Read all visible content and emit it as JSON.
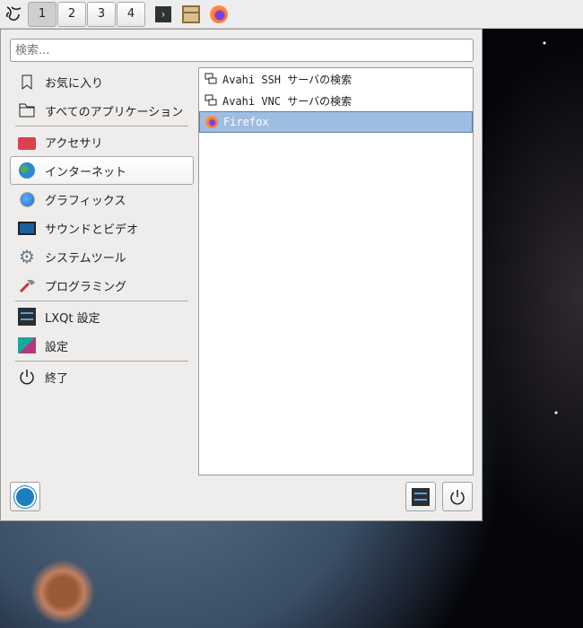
{
  "taskbar": {
    "desktops": [
      "1",
      "2",
      "3",
      "4"
    ],
    "active_desktop": "1",
    "icons": [
      "lxqt-logo-icon",
      "terminal-icon",
      "file-manager-icon",
      "firefox-icon"
    ]
  },
  "menu": {
    "search_placeholder": "検索...",
    "categories": [
      {
        "label": "お気に入り",
        "icon": "bookmark-icon"
      },
      {
        "label": "すべてのアプリケーション",
        "icon": "folder-icon"
      },
      {
        "label": "アクセサリ",
        "icon": "toolbox-icon"
      },
      {
        "label": "インターネット",
        "icon": "globe-icon",
        "selected": true
      },
      {
        "label": "グラフィックス",
        "icon": "graphics-icon"
      },
      {
        "label": "サウンドとビデオ",
        "icon": "monitor-play-icon"
      },
      {
        "label": "システムツール",
        "icon": "gear-icon"
      },
      {
        "label": "プログラミング",
        "icon": "hammer-icon"
      },
      {
        "label": "LXQt 設定",
        "icon": "lxqt-settings-icon"
      },
      {
        "label": "設定",
        "icon": "settings-icon"
      },
      {
        "label": "終了",
        "icon": "power-icon"
      }
    ],
    "apps": [
      {
        "label": "Avahi SSH サーバの検索",
        "icon": "network-icon"
      },
      {
        "label": "Avahi VNC サーバの検索",
        "icon": "network-icon"
      },
      {
        "label": "Firefox",
        "icon": "firefox-icon",
        "selected": true
      }
    ]
  },
  "colors": {
    "selection": "#9fbde0",
    "panel": "#efedeb"
  }
}
